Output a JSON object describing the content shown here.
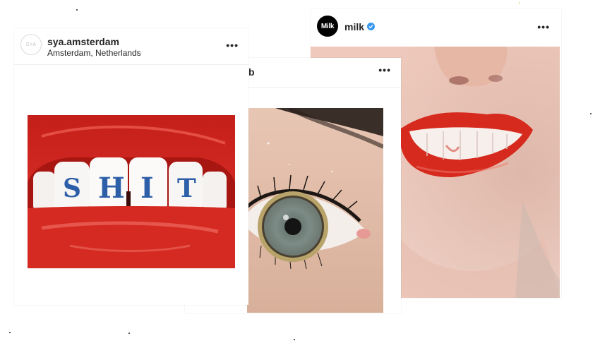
{
  "cards": {
    "sya": {
      "avatar_text": "SYA",
      "username": "sya.amsterdam",
      "location": "Amsterdam, Netherlands",
      "chevron": "›",
      "more": "•••",
      "photo_letters": [
        "S",
        "H",
        "I",
        "T"
      ]
    },
    "eye": {
      "username_fragment": "b",
      "more": "•••"
    },
    "milk": {
      "avatar_text": "Milk",
      "username": "milk",
      "verified_icon": "verified-badge-icon",
      "more": "•••"
    }
  },
  "colors": {
    "lip_red": "#d62a1e",
    "letter_blue": "#2d5fa8",
    "iris": "#7d8b86",
    "ring_gold": "#b8a36a",
    "verified_blue": "#3897f0",
    "skin": "#e9c5b8"
  }
}
